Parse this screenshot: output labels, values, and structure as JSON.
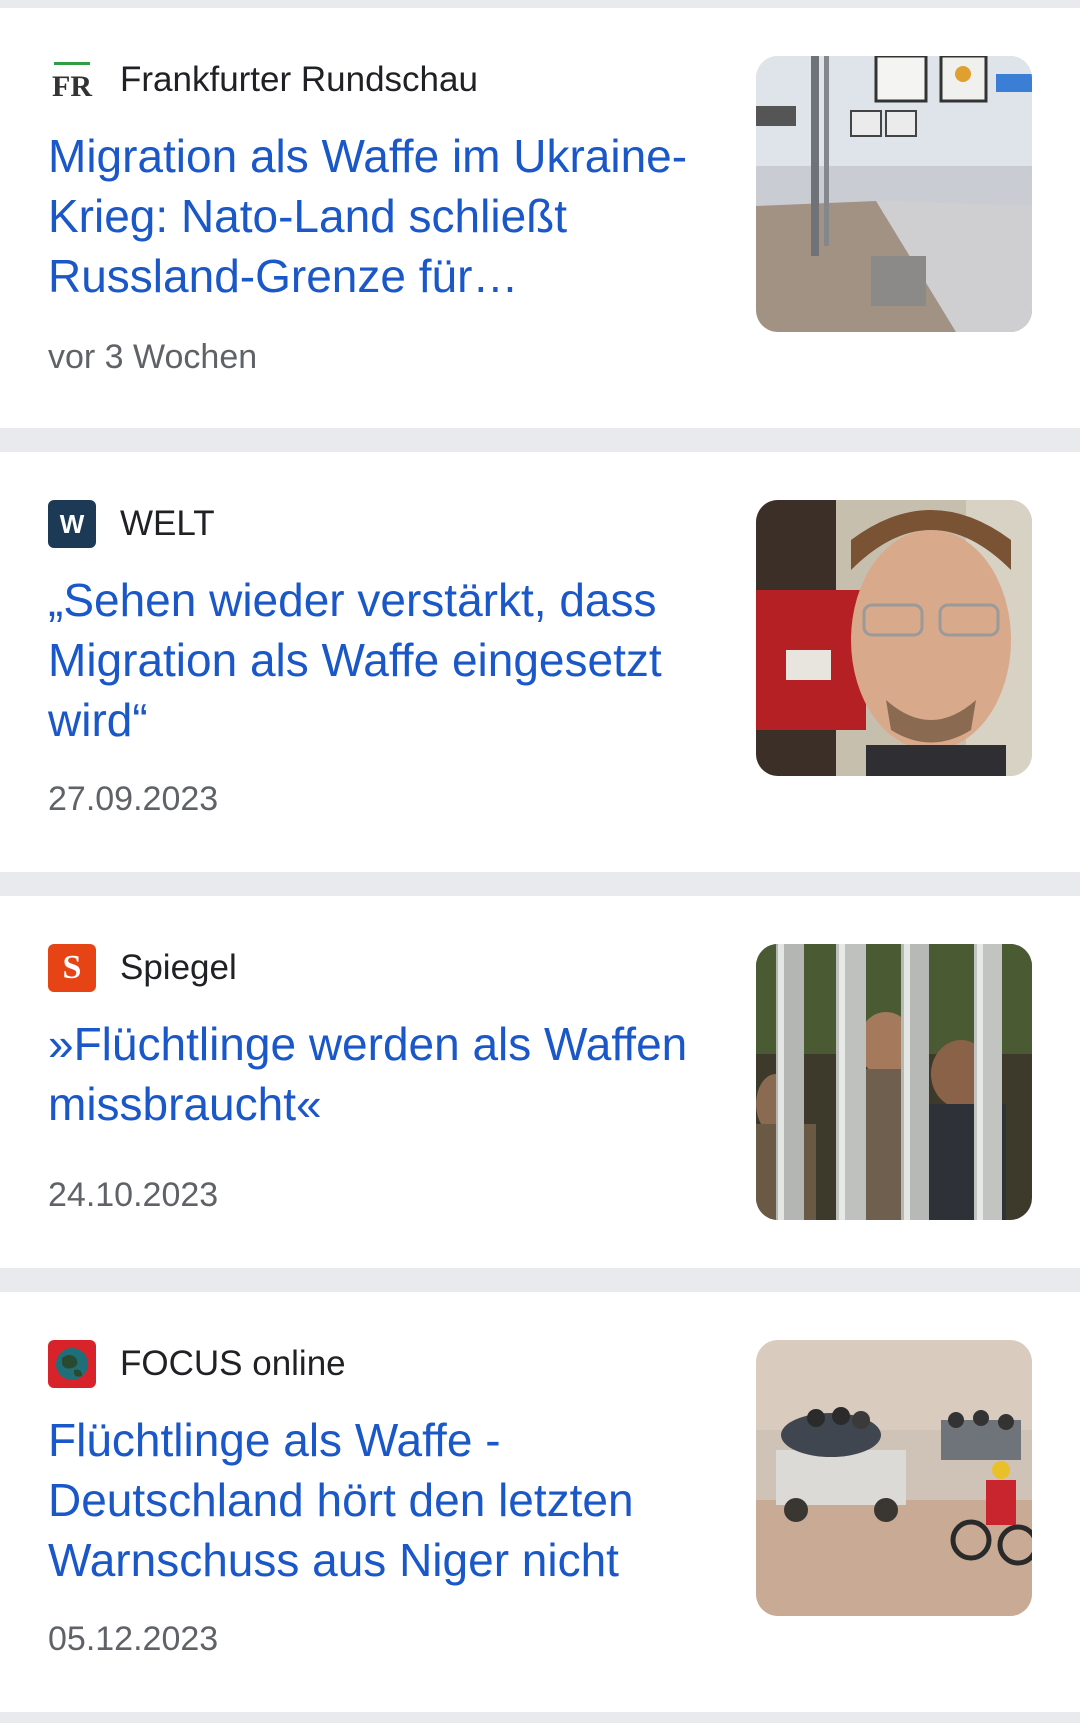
{
  "articles": [
    {
      "source": "Frankfurter Rundschau",
      "logo_text": "FR",
      "headline": "Migration als Waffe im Ukraine-Krieg: Nato-Land schließt Russland-Grenze für…",
      "time": "vor 3 Wochen",
      "thumb_icon": "border-checkpoint-photo"
    },
    {
      "source": "WELT",
      "logo_text": "W",
      "headline": "„Sehen wieder verstärkt, dass Migration als Waffe eingesetzt wird“",
      "time": "27.09.2023",
      "thumb_icon": "portrait-photo"
    },
    {
      "source": "Spiegel",
      "logo_text": "S",
      "headline": "»Flüchtlinge werden als Waffen missbraucht«",
      "time": "24.10.2023",
      "thumb_icon": "border-fence-children-photo"
    },
    {
      "source": "FOCUS online",
      "logo_text": "",
      "headline": "Flüchtlinge als Waffe - Deutschland hört den letzten Warnschuss aus Niger nicht",
      "time": "05.12.2023",
      "thumb_icon": "desert-vehicles-photo"
    }
  ],
  "colors": {
    "headline": "#1a57c8",
    "meta": "#5f6368",
    "separator": "#e8eaed",
    "welt_logo": "#1c3a56",
    "spiegel_logo": "#e64415",
    "focus_logo": "#d8232a"
  }
}
